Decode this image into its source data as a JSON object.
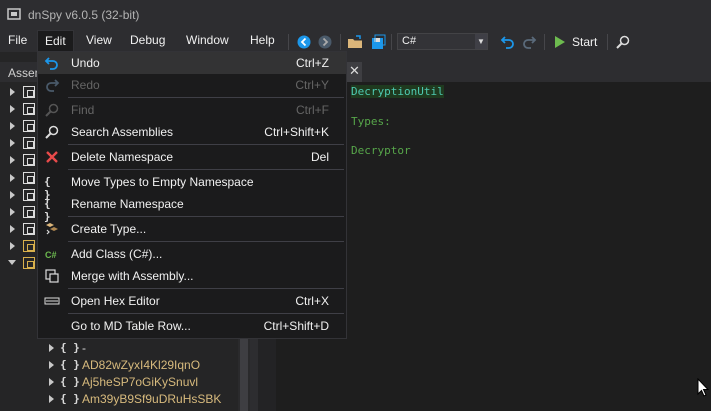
{
  "window": {
    "title": "dnSpy v6.0.5 (32-bit)"
  },
  "menubar": {
    "items": [
      {
        "label": "File"
      },
      {
        "label": "Edit"
      },
      {
        "label": "View"
      },
      {
        "label": "Debug"
      },
      {
        "label": "Window"
      },
      {
        "label": "Help"
      }
    ]
  },
  "toolbar": {
    "language": "C#",
    "start_label": "Start"
  },
  "assembly_explorer": {
    "title": "Assem",
    "tree": [
      {
        "label": "-"
      },
      {
        "label": "AD82wZyxI4Kl29IqnO"
      },
      {
        "label": "Aj5heSP7oGiKySnuvl"
      },
      {
        "label": "Am39yB9Sf9uDRuHsSBK"
      }
    ]
  },
  "editor": {
    "lines": [
      "DecryptionUtil",
      "Types:",
      "Decryptor"
    ]
  },
  "edit_menu": {
    "items": [
      {
        "label": "Undo",
        "shortcut": "Ctrl+Z",
        "icon": "undo-icon",
        "enabled": true
      },
      {
        "label": "Redo",
        "shortcut": "Ctrl+Y",
        "icon": "redo-icon",
        "enabled": false
      },
      {
        "label": "Find",
        "shortcut": "Ctrl+F",
        "icon": "find-icon",
        "enabled": false
      },
      {
        "label": "Search Assemblies",
        "shortcut": "Ctrl+Shift+K",
        "icon": "search-icon",
        "enabled": true
      },
      {
        "label": "Delete Namespace",
        "shortcut": "Del",
        "icon": "delete-icon",
        "enabled": true
      },
      {
        "label": "Move Types to Empty Namespace",
        "shortcut": "",
        "icon": "namespace-icon",
        "enabled": true
      },
      {
        "label": "Rename Namespace",
        "shortcut": "",
        "icon": "namespace-icon",
        "enabled": true
      },
      {
        "label": "Create Type...",
        "shortcut": "",
        "icon": "create-type-icon",
        "enabled": true
      },
      {
        "label": "Add Class (C#)...",
        "shortcut": "",
        "icon": "csharp-icon",
        "enabled": true
      },
      {
        "label": "Merge with Assembly...",
        "shortcut": "",
        "icon": "merge-icon",
        "enabled": true
      },
      {
        "label": "Open Hex Editor",
        "shortcut": "Ctrl+X",
        "icon": "hex-editor-icon",
        "enabled": true
      },
      {
        "label": "Go to MD Table Row...",
        "shortcut": "Ctrl+Shift+D",
        "icon": "",
        "enabled": true
      }
    ]
  },
  "colors": {
    "accent": "#007acc",
    "menu_bg": "#1b1b1c",
    "namespace_text": "#d7ba7d",
    "type_text": "#4ec9b0"
  }
}
